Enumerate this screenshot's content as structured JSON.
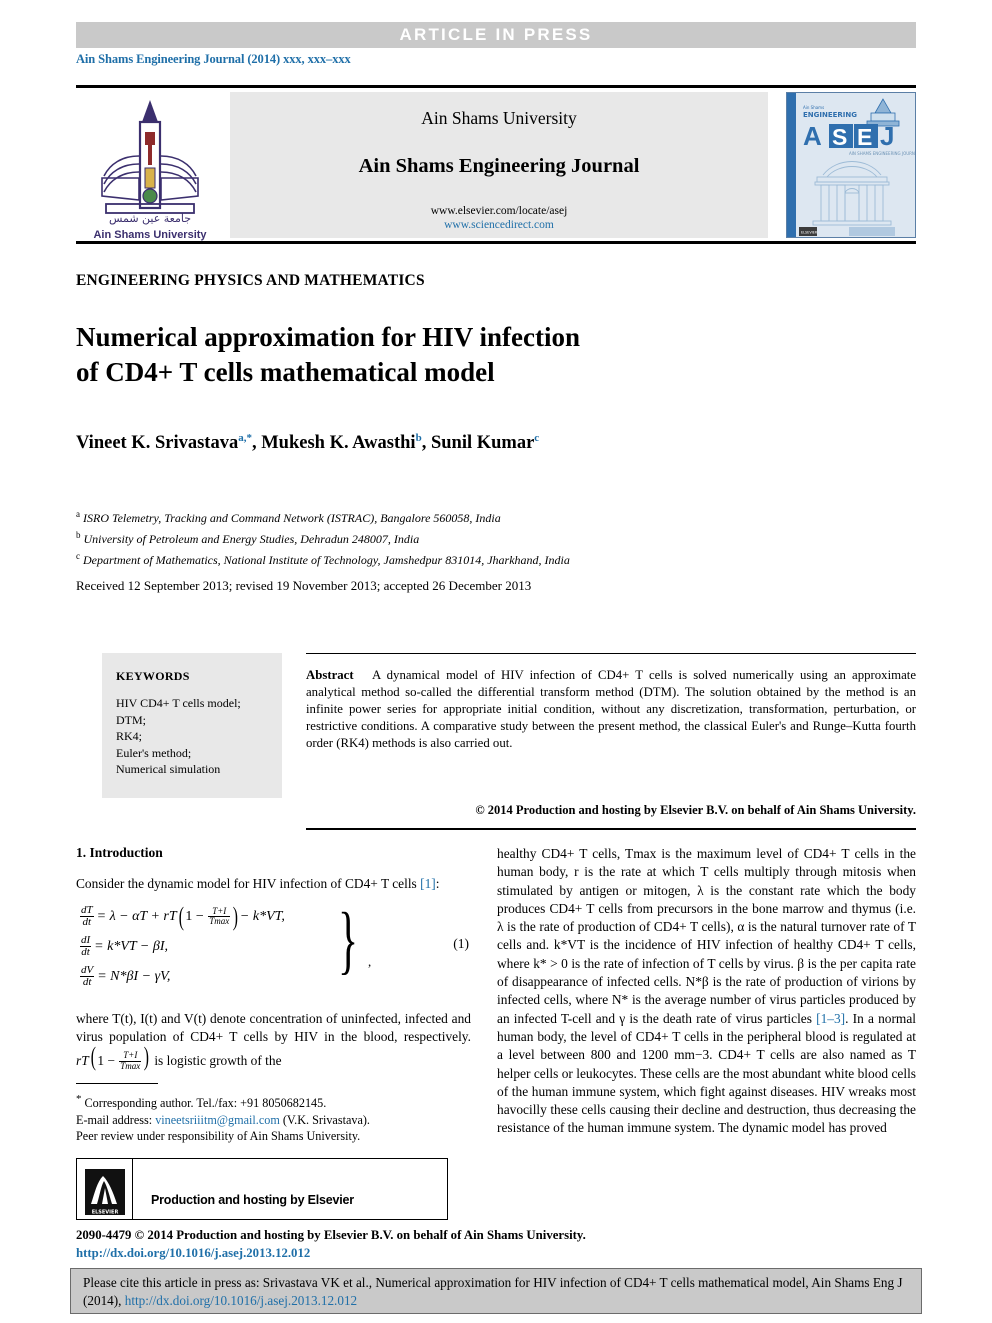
{
  "banner": {
    "text": "ARTICLE  IN  PRESS"
  },
  "journal_ref": "Ain Shams Engineering Journal (2014) xxx, xxx–xxx",
  "masthead": {
    "university": "Ain Shams University",
    "journal_title": "Ain Shams Engineering Journal",
    "url_elsevier": "www.elsevier.com/locate/asej",
    "url_sciencedirect": "www.sciencedirect.com",
    "logo_caption": "Ain Shams University",
    "cover_label_top": "ENGINEERING",
    "cover_label_main": "ASEJ",
    "cover_label_sub": "AIN SHAMS ENGINEERING JOURNAL",
    "accent_blue": "#1f6fa8",
    "banner_gray": "#c9c9c9"
  },
  "section_label": "ENGINEERING PHYSICS AND MATHEMATICS",
  "title_line1": "Numerical approximation for HIV infection",
  "title_line2": "of CD4+  T cells mathematical model",
  "authors": [
    {
      "name": "Vineet K. Srivastava",
      "marks": "a,*"
    },
    {
      "name": "Mukesh K. Awasthi",
      "marks": "b"
    },
    {
      "name": "Sunil Kumar",
      "marks": "c"
    }
  ],
  "affiliations": [
    {
      "mark": "a",
      "text": "ISRO Telemetry, Tracking and Command Network (ISTRAC), Bangalore 560058, India"
    },
    {
      "mark": "b",
      "text": "University of Petroleum and Energy Studies, Dehradun 248007, India"
    },
    {
      "mark": "c",
      "text": "Department of Mathematics, National Institute of Technology, Jamshedpur 831014, Jharkhand, India"
    }
  ],
  "dates": "Received 12 September 2013; revised 19 November 2013; accepted 26 December 2013",
  "keywords": {
    "heading": "KEYWORDS",
    "items": [
      "HIV CD4+ T cells model;",
      "DTM;",
      "RK4;",
      "Euler's method;",
      "Numerical simulation"
    ]
  },
  "abstract": {
    "label": "Abstract",
    "text": "A dynamical model of HIV infection of CD4+ T cells is solved numerically using an approximate analytical method so-called the differential transform method (DTM). The solution obtained by the method is an infinite power series for appropriate initial condition, without any discretization, transformation, perturbation, or restrictive conditions. A comparative study between the present method, the classical Euler's and Runge–Kutta fourth order (RK4) methods is also carried out.",
    "copyright": "© 2014 Production and hosting by Elsevier B.V. on behalf of Ain Shams University."
  },
  "intro": {
    "heading": "1. Introduction",
    "para1_a": "Consider the dynamic model for HIV infection of CD4+ T cells ",
    "para1_ref": "[1]",
    "para1_b": ":",
    "equation": {
      "number": "(1)",
      "line1_lhs_num": "dT",
      "line1_lhs_den": "dt",
      "line1_rhs": "= λ − αT + rT",
      "line1_frac_num": "T+I",
      "line1_frac_den": "Tmax",
      "line1_tail": "− k*VT,",
      "line2_lhs_num": "dI",
      "line2_lhs_den": "dt",
      "line2_rhs": "= k*VT − βI,",
      "line3_lhs_num": "dV",
      "line3_lhs_den": "dt",
      "line3_rhs": "= N*βI − γV,"
    },
    "para2_a": "where T(t), I(t) and V(t) denote concentration of uninfected, infected and virus population of CD4+ T cells by HIV in the blood, respectively. ",
    "para2_b": " is logistic growth of the"
  },
  "footnotes": {
    "corresponding": "Corresponding author. Tel./fax: +91 8050682145.",
    "email_label": "E-mail address: ",
    "email": "vineetsriiitm@gmail.com",
    "email_tail": " (V.K. Srivastava).",
    "peer_review": "Peer review under responsibility of Ain Shams University."
  },
  "elsevier_box": {
    "logo_text": "ELSEVIER",
    "caption": "Production and hosting by Elsevier"
  },
  "right_column": {
    "para_a": "healthy CD4+ T cells, Tmax is the maximum level of CD4+ T cells in the human body, r is the rate at which T cells multiply through mitosis when stimulated by antigen or mitogen, λ is the constant rate which the body produces CD4+ T cells from precursors in the bone marrow and thymus (i.e. λ is the rate of production of CD4+ T cells), α is the natural turnover rate of T cells and. k*VT is the incidence of HIV infection of healthy CD4+ T cells, where k* > 0 is the rate of infection of T cells by virus. β is the per capita rate of disappearance of infected cells. N*β is the rate of production of virions by infected cells, where N* is the average number of virus particles produced by an infected T-cell and γ is the death rate of virus particles ",
    "ref": "[1–3]",
    "para_b": ". In a normal human body, the level of CD4+ T cells in the peripheral blood is regulated at a level between 800 and 1200 mm−3. CD4+ T cells are also named as T helper cells or leukocytes. These cells are the most abundant white blood cells of the human immune system, which fight against diseases. HIV wreaks most havocilly these cells causing their decline and destruction, thus decreasing the resistance of the human immune system. The dynamic model has proved"
  },
  "bottom": {
    "issn": "2090-4479 © 2014 Production and hosting by Elsevier B.V. on behalf of Ain Shams University.",
    "doi": "http://dx.doi.org/10.1016/j.asej.2013.12.012",
    "cite_a": "Please cite this article in press as: Srivastava VK et al., Numerical approximation for HIV infection of CD4+ T cells mathematical model, Ain Shams Eng J (2014), ",
    "cite_link": "http://dx.doi.org/10.1016/j.asej.2013.12.012"
  }
}
